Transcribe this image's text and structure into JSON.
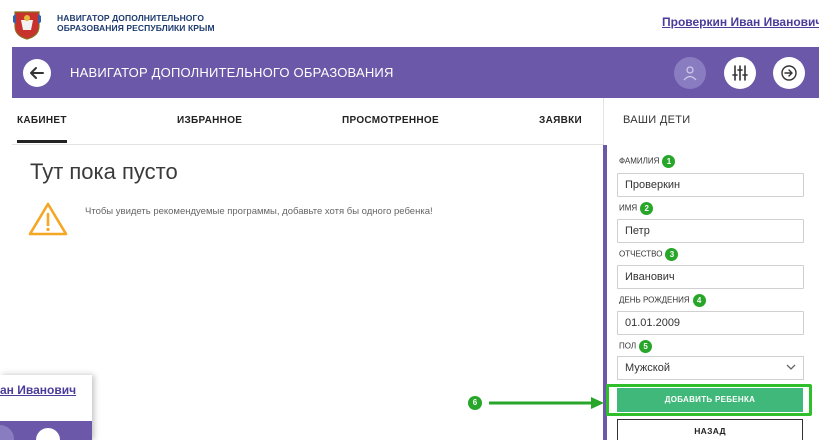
{
  "site": {
    "title_line1": "НАВИГАТОР ДОПОЛНИТЕЛЬНОГО",
    "title_line2": "ОБРАЗОВАНИЯ РЕСПУБЛИКИ КРЫМ",
    "user_name": "Проверкин Иван Иванович"
  },
  "topbar": {
    "title": "НАВИГАТОР ДОПОЛНИТЕЛЬНОГО ОБРАЗОВАНИЯ",
    "icons": [
      "arrow-left-icon",
      "user-icon",
      "filter-sliders-icon",
      "logout-arrow-icon"
    ]
  },
  "tabs": [
    {
      "label": "КАБИНЕТ",
      "active": true
    },
    {
      "label": "ИЗБРАННОЕ",
      "active": false
    },
    {
      "label": "ПРОСМОТРЕННОЕ",
      "active": false
    },
    {
      "label": "ЗАЯВКИ",
      "active": false
    }
  ],
  "main": {
    "empty_title": "Тут пока пусто",
    "empty_message": "Чтобы увидеть рекомендуемые программы, добавьте хотя бы одного ребенка!"
  },
  "kids_panel": {
    "heading": "ВАШИ ДЕТИ",
    "fields": [
      {
        "label": "ФАМИЛИЯ",
        "badge": "1",
        "value": "Проверкин"
      },
      {
        "label": "ИМЯ",
        "badge": "2",
        "value": "Петр"
      },
      {
        "label": "ОТЧЕСТВО",
        "badge": "3",
        "value": "Иванович"
      },
      {
        "label": "ДЕНЬ РОЖДЕНИЯ",
        "badge": "4",
        "value": "01.01.2009"
      }
    ],
    "gender": {
      "label": "ПОЛ",
      "badge": "5",
      "selected": "Мужской"
    },
    "add_button": "ДОБАВИТЬ РЕБЕНКА",
    "back_button": "НАЗАД",
    "step6_badge": "6"
  },
  "inset": {
    "user_name_fragment": "ан Иванович"
  },
  "colors": {
    "brand_purple": "#6b58a8",
    "accent_green": "#3fb879",
    "highlight_green": "#2fbf2a",
    "badge_green": "#27a62a",
    "link": "#4a3c9a"
  }
}
